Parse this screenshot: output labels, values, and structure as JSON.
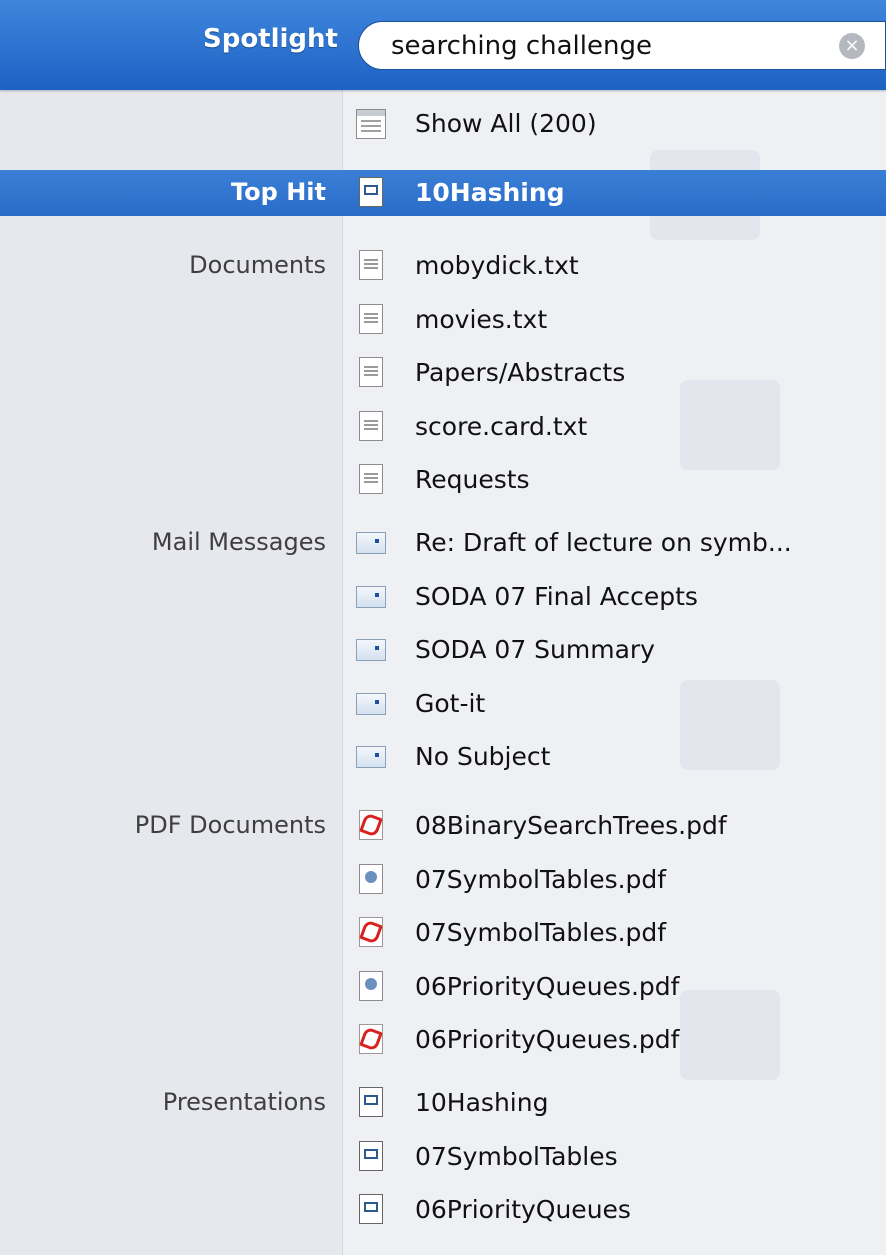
{
  "header": {
    "title": "Spotlight",
    "query": "searching challenge"
  },
  "show_all": {
    "label": "Show All (200)"
  },
  "top_hit": {
    "category": "Top Hit",
    "label": "10Hashing"
  },
  "sections": [
    {
      "category": "Documents",
      "items": [
        {
          "label": "mobydick.txt",
          "icon": "text-document-icon"
        },
        {
          "label": "movies.txt",
          "icon": "text-document-icon"
        },
        {
          "label": "Papers/Abstracts",
          "icon": "text-document-icon"
        },
        {
          "label": "score.card.txt",
          "icon": "text-document-icon"
        },
        {
          "label": "Requests",
          "icon": "text-document-icon"
        }
      ]
    },
    {
      "category": "Mail Messages",
      "items": [
        {
          "label": "Re: Draft of lecture on symb...",
          "icon": "mail-message-icon"
        },
        {
          "label": "SODA 07 Final Accepts",
          "icon": "mail-message-icon"
        },
        {
          "label": "SODA 07 Summary",
          "icon": "mail-message-icon"
        },
        {
          "label": "Got-it",
          "icon": "mail-message-icon"
        },
        {
          "label": "No Subject",
          "icon": "mail-message-icon"
        }
      ]
    },
    {
      "category": "PDF Documents",
      "items": [
        {
          "label": "08BinarySearchTrees.pdf",
          "icon": "acrobat-pdf-icon"
        },
        {
          "label": "07SymbolTables.pdf",
          "icon": "preview-pdf-icon"
        },
        {
          "label": "07SymbolTables.pdf",
          "icon": "acrobat-pdf-icon"
        },
        {
          "label": "06PriorityQueues.pdf",
          "icon": "preview-pdf-icon"
        },
        {
          "label": "06PriorityQueues.pdf",
          "icon": "acrobat-pdf-icon"
        }
      ]
    },
    {
      "category": "Presentations",
      "items": [
        {
          "label": "10Hashing",
          "icon": "keynote-presentation-icon"
        },
        {
          "label": "07SymbolTables",
          "icon": "keynote-presentation-icon"
        },
        {
          "label": "06PriorityQueues",
          "icon": "keynote-presentation-icon"
        }
      ]
    }
  ]
}
